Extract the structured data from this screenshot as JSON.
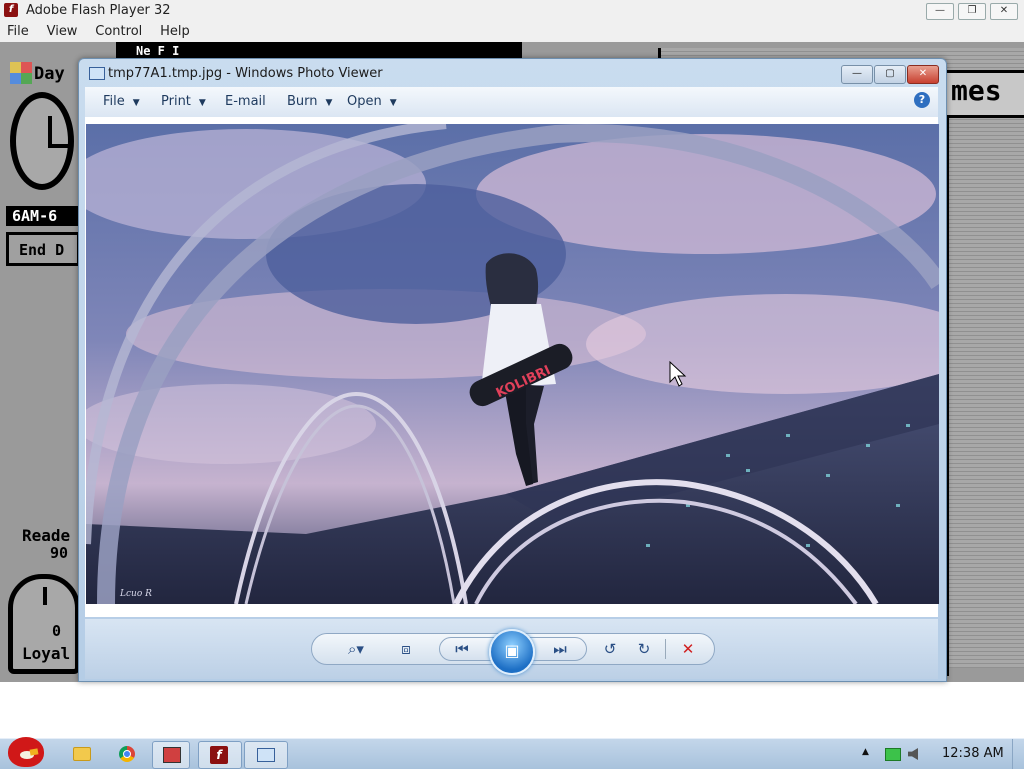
{
  "flash_window": {
    "title": "Adobe Flash Player 32",
    "menu": [
      "File",
      "View",
      "Control",
      "Help"
    ],
    "buttons": {
      "minimize": "—",
      "restore": "❐",
      "close": "✕"
    }
  },
  "game": {
    "day_label": "Day",
    "time_range": "6AM-6",
    "end_day": "End D",
    "readers_label": "Reade",
    "readers_value": "90",
    "loyalty_label": "Loyal",
    "loyalty_value": "0",
    "top_title": "Ne   F   I",
    "right_title": "mes"
  },
  "photo_viewer": {
    "title": "tmp77A1.tmp.jpg - Windows Photo Viewer",
    "toolbar": [
      {
        "label": "File",
        "dropdown": true
      },
      {
        "label": "Print",
        "dropdown": true
      },
      {
        "label": "E-mail",
        "dropdown": false
      },
      {
        "label": "Burn",
        "dropdown": true
      },
      {
        "label": "Open",
        "dropdown": true
      }
    ],
    "help_glyph": "?",
    "image_signature": "Lcuo R",
    "image_sign_text": "KOLIBRI",
    "controls": {
      "zoom": "⌕▾",
      "fit": "⧈",
      "prev": "⏮",
      "slideshow": "▣",
      "next": "⏭",
      "rotate_ccw": "↺",
      "rotate_cw": "↻",
      "delete": "✕"
    }
  },
  "taskbar": {
    "clock": "12:38 AM",
    "tray_arrow": "▲",
    "colors": {
      "accent": "#2f6fc0",
      "delete": "#d02020"
    }
  }
}
